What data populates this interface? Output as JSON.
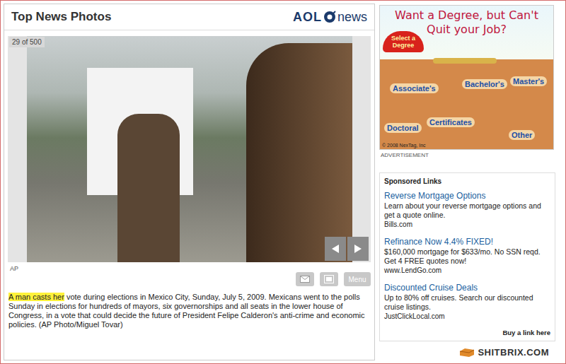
{
  "header": {
    "title": "Top News Photos",
    "logo_main": "AOL",
    "logo_suffix": "news"
  },
  "photo": {
    "counter": "29 of 500",
    "credit": "AP"
  },
  "tools": {
    "menu": "Menu"
  },
  "caption": {
    "highlight": "A man casts her",
    "text": " vote during elections in Mexico City, Sunday, July 5, 2009. Mexicans went to the polls Sunday in elections for hundreds of mayors, six governorships and all seats in the lower house of Congress, in a vote that could decide the future of President Felipe Calderon's anti-crime and economic policies. (AP Photo/Miguel Tovar)"
  },
  "ad": {
    "title": "Want a Degree, but Can't Quit your Job?",
    "badge": "Select a Degree",
    "options": [
      "Associate's",
      "Bachelor's",
      "Master's",
      "Doctoral",
      "Certificates",
      "Other"
    ],
    "copyright": "© 2008 NexTag, Inc",
    "label": "ADVERTISEMENT"
  },
  "sponsored": {
    "title": "Sponsored Links",
    "links": [
      {
        "title": "Reverse Mortgage Options",
        "description": "Learn about your reverse mortgage options and get a quote online.",
        "url": "Bills.com"
      },
      {
        "title": "Refinance Now 4.4% FIXED!",
        "description": "$160,000 mortgage for $633/mo. No SSN reqd. Get 4 FREE quotes now!",
        "url": "www.LendGo.com"
      },
      {
        "title": "Discounted Cruise Deals",
        "description": "Up to 80% off cruises. Search our discounted cruise listings.",
        "url": "JustClickLocal.com"
      }
    ],
    "buy": "Buy a link here"
  },
  "watermark": "SHITBRIX.COM"
}
